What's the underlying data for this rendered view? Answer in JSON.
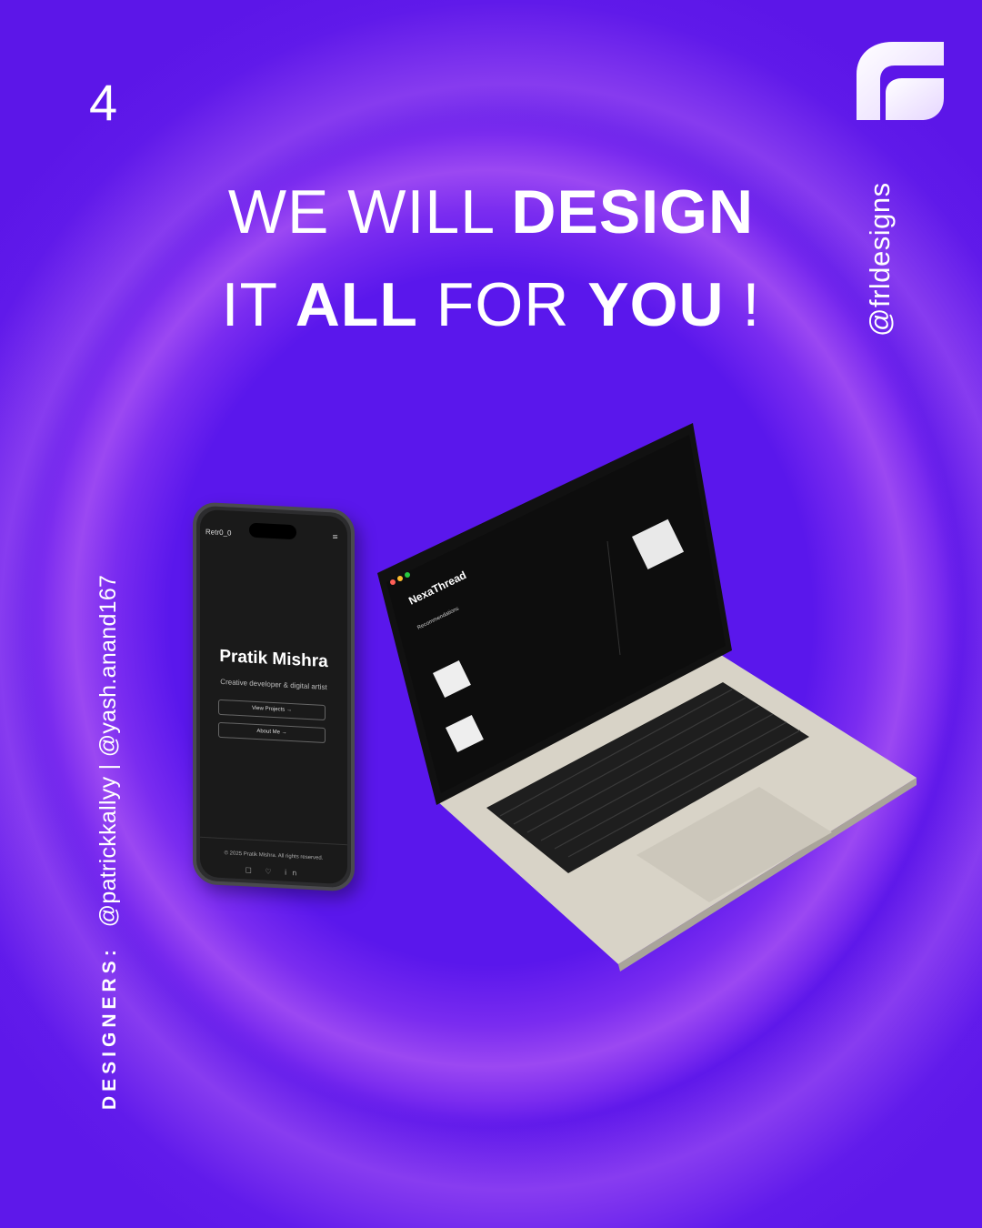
{
  "page_number": "4",
  "headline": {
    "line1_regular": "WE WILL ",
    "line1_bold": "DESIGN",
    "line2_a": "IT ",
    "line2_b": "ALL",
    "line2_c": " FOR ",
    "line2_d": "YOU",
    "line2_e": " !"
  },
  "handle": "@frldesigns",
  "designers": {
    "label": "DESIGNERS:",
    "names": "@patrickkallyy | @yash.anand167"
  },
  "phone": {
    "brand": "Retr0_0",
    "menu_icon": "≡",
    "name": "Pratik Mishra",
    "role": "Creative developer & digital artist",
    "btn1": "View Projects  →",
    "btn2": "About Me  →",
    "copyright": "© 2025 Pratik Mishra. All rights reserved.",
    "icons": "☐ ♡ in"
  },
  "laptop": {
    "site_title": "NexaThread",
    "section": "Recommendations"
  },
  "colors": {
    "background": "#5b16ea",
    "ring": "#9b48f2",
    "text": "#ffffff"
  }
}
